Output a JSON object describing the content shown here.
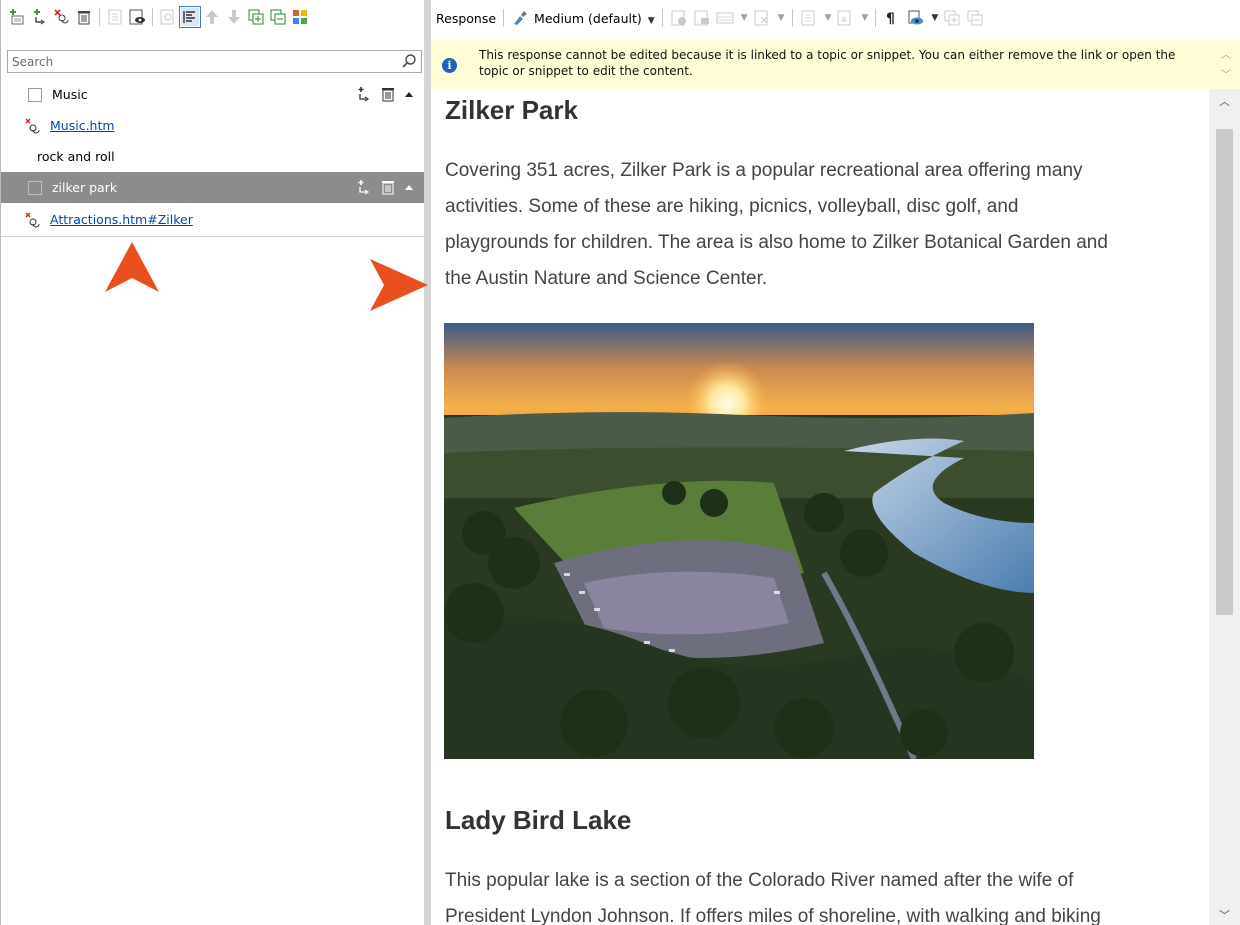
{
  "left_toolbar": {
    "icons": [
      "add-response-icon",
      "add-link-icon",
      "remove-link-icon",
      "delete-icon",
      "import-icon",
      "preview-icon",
      "find-icon",
      "align-icon",
      "move-up-icon",
      "move-down-icon",
      "expand-all-icon",
      "collapse-all-icon",
      "grid-icon"
    ]
  },
  "search": {
    "placeholder": "Search",
    "value": ""
  },
  "tree": [
    {
      "type": "response",
      "label": "Music"
    },
    {
      "type": "link",
      "label": "Music.htm"
    },
    {
      "type": "text",
      "label": "rock and roll"
    },
    {
      "type": "response",
      "label": "zilker park",
      "selected": true
    },
    {
      "type": "link",
      "label": "Attractions.htm#Zilker"
    }
  ],
  "right_toolbar": {
    "response_label": "Response",
    "size_select": "Medium (default)"
  },
  "notice": {
    "text": "This response cannot be edited because it is linked to a topic or snippet. You can either remove the link or open the topic or snippet to edit the content."
  },
  "content": {
    "heading1": "Zilker Park",
    "para1_lines": [
      "Covering 351 acres, Zilker Park is a popular recreational area offering many",
      "activities. Some of these are hiking, picnics, volleyball, disc golf, and",
      "playgrounds for children. The area is also home to Zilker Botanical Garden and",
      "the Austin Nature and Science Center."
    ],
    "heading2": "Lady Bird Lake",
    "para2_lines": [
      "This popular lake is a section of the Colorado River named after the wife of",
      "President Lyndon Johnson. If offers miles of shoreline, with walking and biking"
    ]
  },
  "colors": {
    "callout": "#e8511f",
    "selected_row": "#8c8c8c",
    "notice_bg": "#fffed6",
    "link": "#0645ad"
  }
}
